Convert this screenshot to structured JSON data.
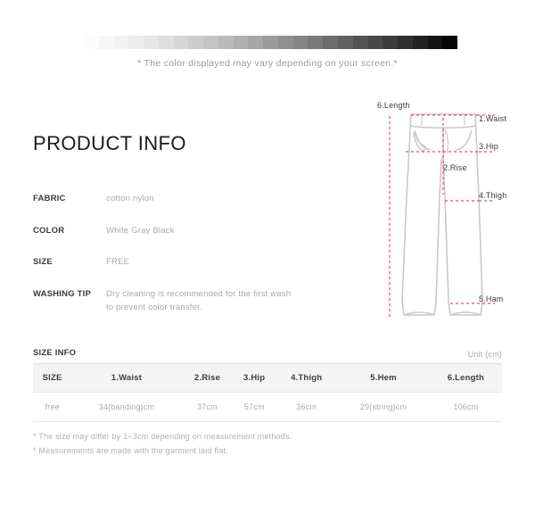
{
  "swatch": {
    "note": "* The color displayed may vary depending on your screen.*",
    "steps": [
      "#fcfcfc",
      "#f7f7f7",
      "#f2f2f2",
      "#ededed",
      "#e6e6e6",
      "#dedede",
      "#d6d6d6",
      "#cdcdcd",
      "#c4c4c4",
      "#bababa",
      "#b0b0b0",
      "#a6a6a6",
      "#9b9b9b",
      "#909090",
      "#858585",
      "#797979",
      "#6d6d6d",
      "#616161",
      "#555555",
      "#484848",
      "#3c3c3c",
      "#2f2f2f",
      "#222222",
      "#141414",
      "#060606"
    ]
  },
  "product_info": {
    "title": "PRODUCT INFO",
    "rows": [
      {
        "label": "FABRIC",
        "value": "cotton  nylon"
      },
      {
        "label": "COLOR",
        "value": "White Gray Black"
      },
      {
        "label": "SIZE",
        "value": "FREE"
      },
      {
        "label": "WASHING TIP",
        "value": "Dry cleaning is recommended for the first wash to prevent color transfer."
      }
    ]
  },
  "diagram": {
    "labels": {
      "length": "6.Length",
      "waist": "1.Waist",
      "hip": "3.Hip",
      "rise": "2.Rise",
      "thigh": "4.Thigh",
      "ham": "5.Ham"
    },
    "guide_color": "#f4485c",
    "outline_color": "#c9c9c9"
  },
  "size_info": {
    "title": "SIZE INFO",
    "unit": "Unit (cm)",
    "columns": [
      "SIZE",
      "1.Waist",
      "2.Rise",
      "3.Hip",
      "4.Thigh",
      "5.Hem",
      "6.Length"
    ],
    "rows": [
      [
        "free",
        "34(banding)cm",
        "37cm",
        "57cm",
        "36cm",
        "29(string)cm",
        "106cm"
      ]
    ],
    "notes": [
      "* The size may differ by 1~3cm depending on measurement methods.",
      "* Measurements are made with the garment laid flat."
    ]
  }
}
